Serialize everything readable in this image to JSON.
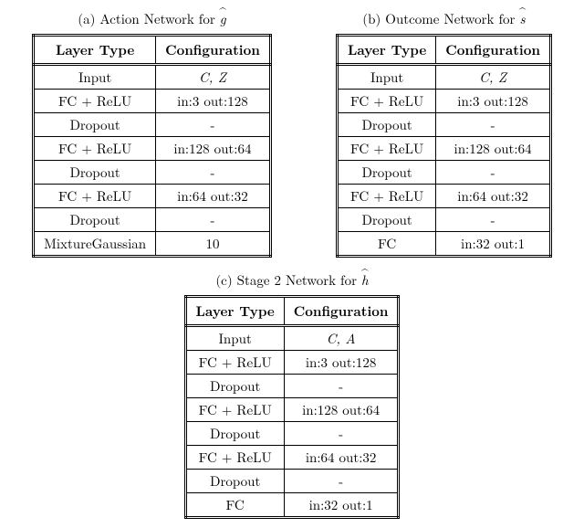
{
  "tableA": {
    "caption_prefix": "(a) Action Network for ",
    "caption_hat": "g",
    "header": {
      "c0": "Layer Type",
      "c1": "Configuration"
    },
    "rows": [
      {
        "c0": "Input",
        "c1": "C, Z",
        "c1_ital": true
      },
      {
        "c0": "FC + ReLU",
        "c1": "in:3 out:128"
      },
      {
        "c0": "Dropout",
        "c1": "-"
      },
      {
        "c0": "FC + ReLU",
        "c1": "in:128 out:64"
      },
      {
        "c0": "Dropout",
        "c1": "-"
      },
      {
        "c0": "FC + ReLU",
        "c1": "in:64 out:32"
      },
      {
        "c0": "Dropout",
        "c1": "-"
      },
      {
        "c0": "MixtureGaussian",
        "c1": "10"
      }
    ]
  },
  "tableB": {
    "caption_prefix": "(b) Outcome Network for ",
    "caption_hat": "s",
    "header": {
      "c0": "Layer Type",
      "c1": "Configuration"
    },
    "rows": [
      {
        "c0": "Input",
        "c1": "C, Z",
        "c1_ital": true
      },
      {
        "c0": "FC + ReLU",
        "c1": "in:3 out:128"
      },
      {
        "c0": "Dropout",
        "c1": "-"
      },
      {
        "c0": "FC + ReLU",
        "c1": "in:128 out:64"
      },
      {
        "c0": "Dropout",
        "c1": "-"
      },
      {
        "c0": "FC + ReLU",
        "c1": "in:64 out:32"
      },
      {
        "c0": "Dropout",
        "c1": "-"
      },
      {
        "c0": "FC",
        "c1": "in:32 out:1"
      }
    ]
  },
  "tableC": {
    "caption_prefix": "(c) Stage 2 Network for ",
    "caption_hat": "h",
    "header": {
      "c0": "Layer Type",
      "c1": "Configuration"
    },
    "rows": [
      {
        "c0": "Input",
        "c1": "C, A",
        "c1_ital": true
      },
      {
        "c0": "FC + ReLU",
        "c1": "in:3 out:128"
      },
      {
        "c0": "Dropout",
        "c1": "-"
      },
      {
        "c0": "FC + ReLU",
        "c1": "in:128 out:64"
      },
      {
        "c0": "Dropout",
        "c1": "-"
      },
      {
        "c0": "FC + ReLU",
        "c1": "in:64 out:32"
      },
      {
        "c0": "Dropout",
        "c1": "-"
      },
      {
        "c0": "FC",
        "c1": "in:32 out:1"
      }
    ]
  }
}
